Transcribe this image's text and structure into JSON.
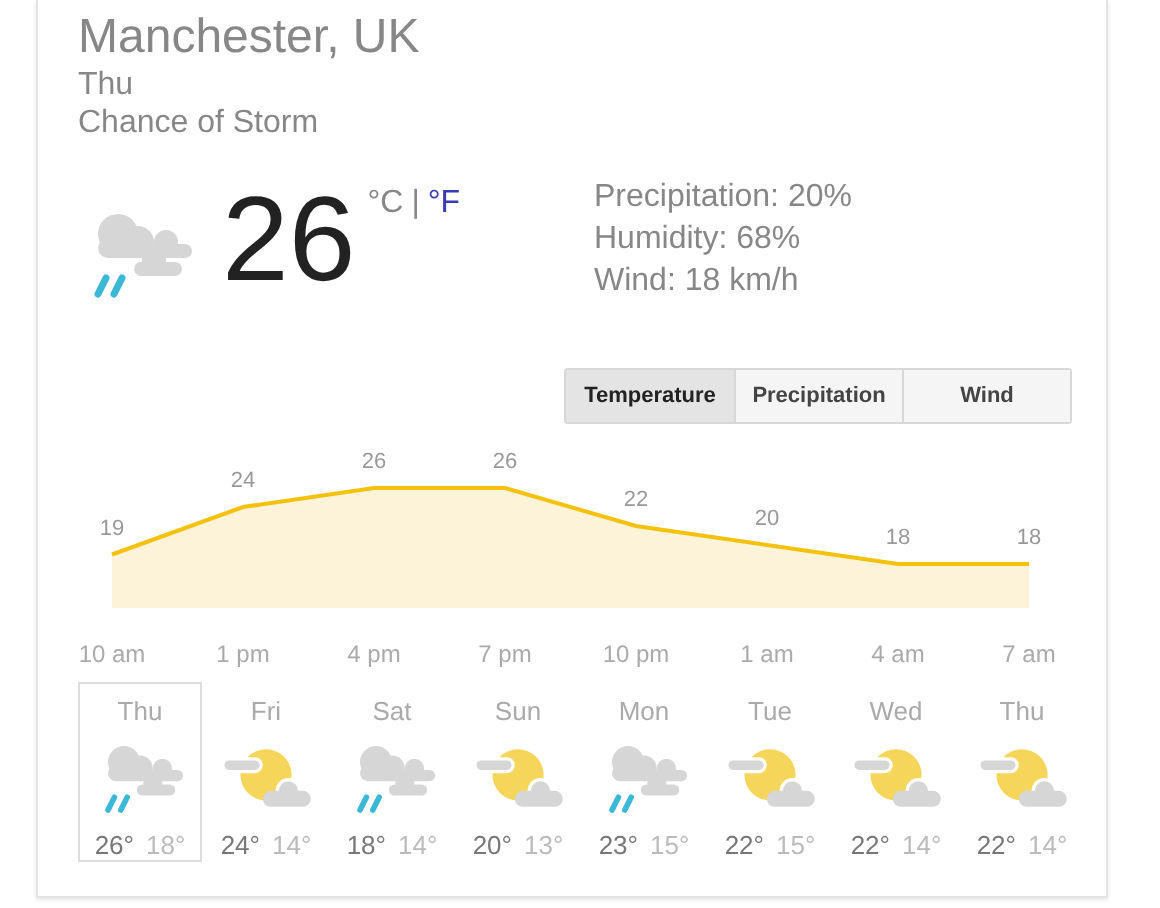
{
  "location": "Manchester, UK",
  "day": "Thu",
  "condition": "Chance of Storm",
  "current": {
    "kind": "storm",
    "temperature": "26",
    "unit_c": "°C",
    "separator": "|",
    "unit_f": "°F"
  },
  "details": [
    "Precipitation: 20%",
    "Humidity: 68%",
    "Wind: 18 km/h"
  ],
  "tabs": [
    {
      "label": "Temperature",
      "selected": true
    },
    {
      "label": "Precipitation",
      "selected": false
    },
    {
      "label": "Wind",
      "selected": false
    }
  ],
  "chart_data": {
    "type": "area",
    "categories": [
      "10 am",
      "1 pm",
      "4 pm",
      "7 pm",
      "10 pm",
      "1 am",
      "4 am",
      "7 am"
    ],
    "values": [
      19,
      24,
      26,
      26,
      22,
      20,
      18,
      18
    ],
    "data_labels": true
  },
  "forecast": [
    {
      "day": "Thu",
      "kind": "storm",
      "high": "26°",
      "low": "18°",
      "selected": true
    },
    {
      "day": "Fri",
      "kind": "partly-sunny",
      "high": "24°",
      "low": "14°",
      "selected": false
    },
    {
      "day": "Sat",
      "kind": "storm",
      "high": "18°",
      "low": "14°",
      "selected": false
    },
    {
      "day": "Sun",
      "kind": "partly-sunny",
      "high": "20°",
      "low": "13°",
      "selected": false
    },
    {
      "day": "Mon",
      "kind": "storm",
      "high": "23°",
      "low": "15°",
      "selected": false
    },
    {
      "day": "Tue",
      "kind": "partly-sunny",
      "high": "22°",
      "low": "15°",
      "selected": false
    },
    {
      "day": "Wed",
      "kind": "partly-sunny",
      "high": "22°",
      "low": "14°",
      "selected": false
    },
    {
      "day": "Thu",
      "kind": "partly-sunny",
      "high": "22°",
      "low": "14°",
      "selected": false
    }
  ]
}
